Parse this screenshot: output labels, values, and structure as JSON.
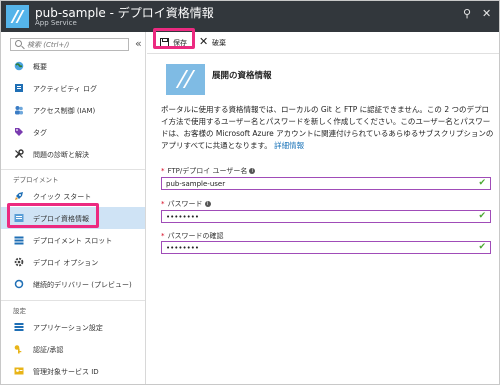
{
  "window": {
    "title": "pub-sample - デプロイ資格情報",
    "subtitle": "App Service",
    "pin_glyph": "⚲",
    "close_glyph": "✕"
  },
  "sidebar": {
    "search_placeholder": "検索 (Ctrl+/)",
    "collapse_glyph": "«",
    "groups": [
      {
        "items": [
          {
            "label": "概要",
            "icon": "globe-icon"
          },
          {
            "label": "アクティビティ ログ",
            "icon": "activity-log-icon"
          },
          {
            "label": "アクセス制御 (IAM)",
            "icon": "iam-users-icon"
          },
          {
            "label": "タグ",
            "icon": "tag-icon"
          },
          {
            "label": "問題の診断と解決",
            "icon": "wrench-icon"
          }
        ]
      },
      {
        "header": "デプロイメント",
        "items": [
          {
            "label": "クイック スタート",
            "icon": "rocket-icon"
          },
          {
            "label": "デプロイ資格情報",
            "icon": "credentials-icon",
            "active": true
          },
          {
            "label": "デプロイメント スロット",
            "icon": "slots-icon"
          },
          {
            "label": "デプロイ オプション",
            "icon": "gear-icon"
          },
          {
            "label": "継続的デリバリー (プレビュー)",
            "icon": "continuous-delivery-icon"
          }
        ]
      },
      {
        "header": "設定",
        "items": [
          {
            "label": "アプリケーション設定",
            "icon": "settings-list-icon"
          },
          {
            "label": "認証/承認",
            "icon": "key-icon"
          },
          {
            "label": "管理対象サービス ID",
            "icon": "identity-icon"
          }
        ]
      }
    ]
  },
  "toolbar": {
    "save_label": "保存",
    "discard_label": "破棄"
  },
  "main": {
    "hero_title": "展開の資格情報",
    "description": "ポータルに使用する資格情報では、ローカルの Git と FTP に認証できません。この 2 つのデプロイ方法で使用するユーザー名とパスワードを新しく作成してください。このユーザー名とパスワードは、お客様の Microsoft Azure アカウントに関連付けられているあらゆるサブスクリプションのアプリすべてに共通となります。",
    "details_link": "詳細情報",
    "fields": {
      "username": {
        "label": "FTP/デプロイ ユーザー名",
        "value": "pub-sample-user"
      },
      "password": {
        "label": "パスワード",
        "value": "••••••••"
      },
      "confirm": {
        "label": "パスワードの確認",
        "value": "••••••••"
      }
    },
    "required_mark": "*",
    "info_glyph": "i",
    "check_glyph": "✔"
  },
  "colors": {
    "titlebar": "#32373c",
    "accent_blue": "#55b4ea",
    "highlight_pink": "#ec2a80",
    "active_item": "#cfe3f5",
    "field_border": "#a04cb8",
    "valid_check": "#4caa32",
    "link": "#1a73b8"
  }
}
